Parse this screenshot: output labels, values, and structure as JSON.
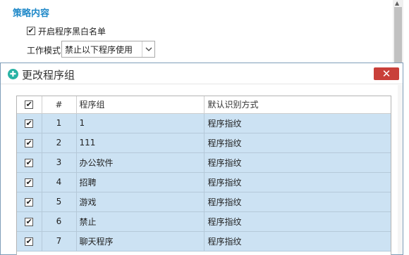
{
  "policy": {
    "section_title": "策略内容",
    "enable_list_label": "开启程序黑白名单",
    "enable_list_checked": true,
    "mode_label": "工作模式",
    "mode_value": "禁止以下程序使用"
  },
  "dialog": {
    "title": "更改程序组",
    "close_glyph": "✕",
    "icon_glyph": "✚"
  },
  "table": {
    "columns": [
      "#",
      "程序组",
      "默认识别方式"
    ],
    "header_checked": true,
    "rows": [
      {
        "num": "1",
        "group": "1",
        "method": "程序指纹",
        "checked": true
      },
      {
        "num": "2",
        "group": "111",
        "method": "程序指纹",
        "checked": true
      },
      {
        "num": "3",
        "group": "办公软件",
        "method": "程序指纹",
        "checked": true
      },
      {
        "num": "4",
        "group": "招聘",
        "method": "程序指纹",
        "checked": true
      },
      {
        "num": "5",
        "group": "游戏",
        "method": "程序指纹",
        "checked": true
      },
      {
        "num": "6",
        "group": "禁止",
        "method": "程序指纹",
        "checked": true
      },
      {
        "num": "7",
        "group": "聊天程序",
        "method": "程序指纹",
        "checked": true
      }
    ]
  },
  "colors": {
    "accent": "#1e88c8",
    "row_selected": "#cce2f3",
    "close_button": "#c9403a",
    "dialog_icon": "#28b3a5"
  },
  "icons": {
    "checkbox": "checkmark-icon",
    "dropdown": "chevron-down-icon",
    "dialog": "plus-circle-icon",
    "close": "close-icon"
  }
}
